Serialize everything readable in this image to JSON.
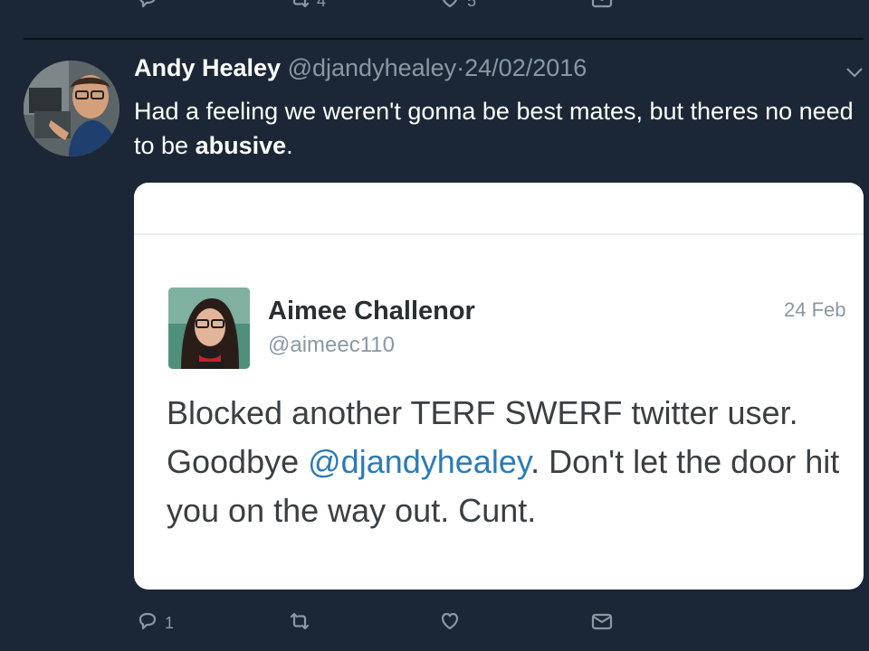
{
  "previous_tweet": {
    "actions": {
      "retweet_count": "4",
      "like_count": "5"
    }
  },
  "tweet": {
    "author_name": "Andy Healey",
    "handle": "@djandyhealey",
    "separator": "·",
    "date": "24/02/2016",
    "text_part1": "Had a feeling we weren't gonna be best mates, but theres no need to be ",
    "text_bold": "abusive",
    "text_part2": ".",
    "embedded_screenshot": {
      "author_name": "Aimee Challenor",
      "handle": "@aimeec110",
      "date": "24 Feb",
      "text_part1": "Blocked another TERF SWERF twitter user. Goodbye ",
      "mention": "@djandyhealey",
      "text_part2": ". Don't let the door hit you on the way out. Cunt."
    },
    "actions": {
      "reply_count": "1"
    }
  },
  "icons": {
    "reply": "reply-icon",
    "retweet": "retweet-icon",
    "like": "heart-icon",
    "dm": "envelope-icon",
    "caret": "chevron-down-icon"
  },
  "colors": {
    "background": "#1b2736",
    "secondary_text": "#8899a6",
    "mention": "#2b7bb9"
  }
}
